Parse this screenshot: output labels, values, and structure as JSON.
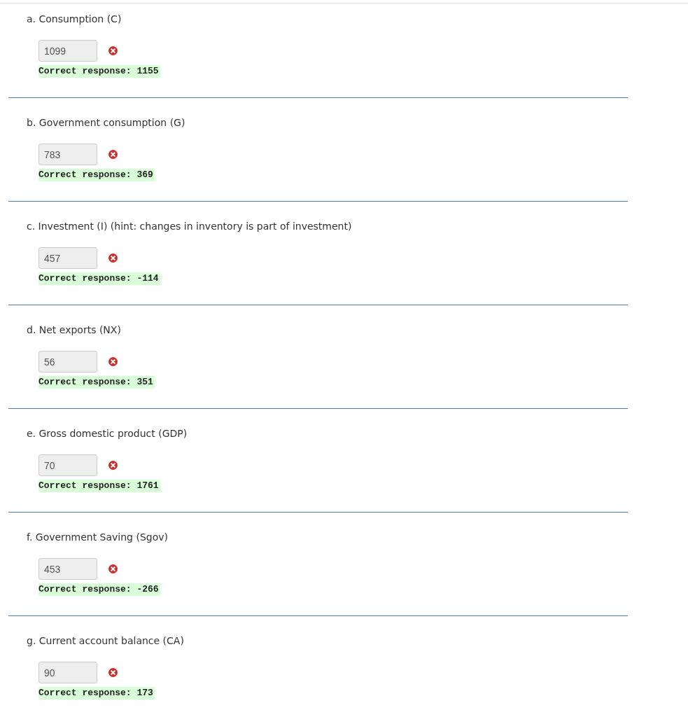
{
  "questions": [
    {
      "label": "a. Consumption (C)",
      "answer": "1099",
      "correct": false,
      "correct_response": "Correct response: 1155"
    },
    {
      "label": "b. Government consumption (G)",
      "answer": "783",
      "correct": false,
      "correct_response": "Correct response: 369"
    },
    {
      "label": "c. Investment (I) (hint: changes in inventory is part of investment)",
      "answer": "457",
      "correct": false,
      "correct_response": "Correct response: -114"
    },
    {
      "label": "d. Net exports (NX)",
      "answer": "56",
      "correct": false,
      "correct_response": "Correct response: 351"
    },
    {
      "label": "e. Gross domestic product (GDP)",
      "answer": "70",
      "correct": false,
      "correct_response": "Correct response: 1761"
    },
    {
      "label": "f. Government Saving (Sgov)",
      "answer": "453",
      "correct": false,
      "correct_response": "Correct response: -266"
    },
    {
      "label": "g. Current account balance (CA)",
      "answer": "90",
      "correct": false,
      "correct_response": "Correct response: 173"
    }
  ]
}
